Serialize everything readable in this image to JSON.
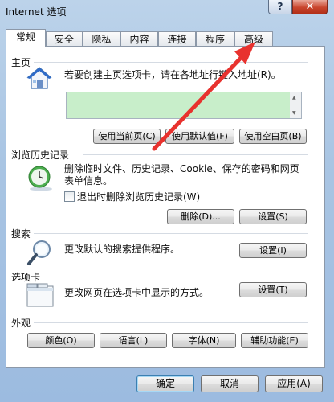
{
  "window": {
    "title": "Internet 选项",
    "help_label": "?",
    "close_label": "✕"
  },
  "tabs": [
    {
      "label": "常规"
    },
    {
      "label": "安全"
    },
    {
      "label": "隐私"
    },
    {
      "label": "内容"
    },
    {
      "label": "连接"
    },
    {
      "label": "程序"
    },
    {
      "label": "高级"
    }
  ],
  "home": {
    "title": "主页",
    "description": "若要创建主页选项卡，请在各地址行键入地址(R)。",
    "value": "",
    "buttons": {
      "use_current": "使用当前页(C)",
      "use_default": "使用默认值(F)",
      "use_blank": "使用空白页(B)"
    }
  },
  "history": {
    "title": "浏览历史记录",
    "description": "删除临时文件、历史记录、Cookie、保存的密码和网页表单信息。",
    "checkbox_label": "退出时删除浏览历史记录(W)",
    "buttons": {
      "delete": "删除(D)...",
      "settings": "设置(S)"
    }
  },
  "search": {
    "title": "搜索",
    "description": "更改默认的搜索提供程序。",
    "settings": "设置(I)"
  },
  "tabs_section": {
    "title": "选项卡",
    "description": "更改网页在选项卡中显示的方式。",
    "settings": "设置(T)"
  },
  "appearance": {
    "title": "外观",
    "buttons": {
      "colors": "颜色(O)",
      "languages": "语言(L)",
      "fonts": "字体(N)",
      "accessibility": "辅助功能(E)"
    }
  },
  "footer": {
    "ok": "确定",
    "cancel": "取消",
    "apply": "应用(A)"
  },
  "colors": {
    "annotation_arrow": "#e8322e",
    "title_bar": "#a9c5e3",
    "close_button": "#c9452d",
    "home_field": "#c8eeca"
  }
}
